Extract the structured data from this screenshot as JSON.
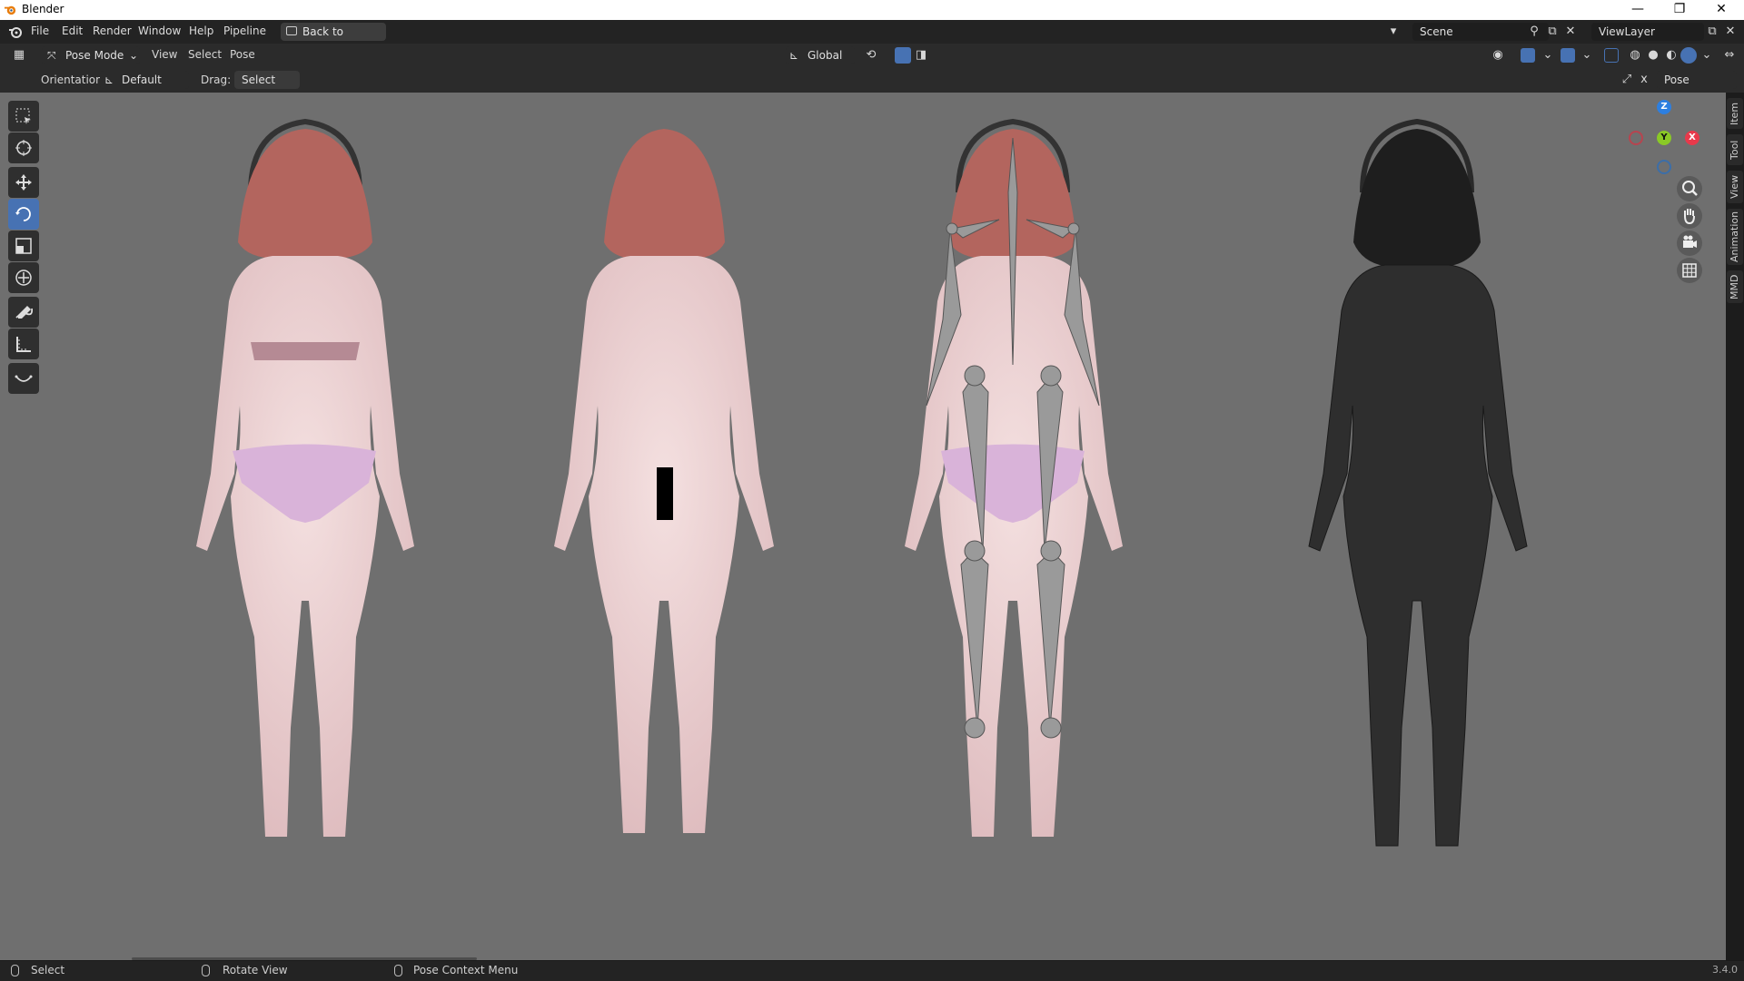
{
  "window": {
    "title": "Blender",
    "minimize": "—",
    "maximize": "❐",
    "close": "✕"
  },
  "menu": {
    "items": [
      "File",
      "Edit",
      "Render",
      "Window",
      "Help",
      "Pipeline"
    ],
    "back_label": "Back to Previous"
  },
  "scene": {
    "label": "Scene",
    "viewlayer": "ViewLayer"
  },
  "header": {
    "mode": "Pose Mode",
    "menus": [
      "View",
      "Select",
      "Pose"
    ],
    "transform_orientation": "Global"
  },
  "tool_settings": {
    "orientation_label": "Orientation:",
    "orientation_value": "Default",
    "drag_label": "Drag:",
    "drag_value": "Select Box",
    "pose_options": "Pose Options"
  },
  "sidebar_tabs": [
    "Item",
    "Tool",
    "View",
    "Animation",
    "MMD"
  ],
  "gizmo": {
    "z": "Z",
    "y": "Y",
    "x": "X"
  },
  "status": {
    "select": "Select",
    "rotate": "Rotate View",
    "context": "Pose Context Menu",
    "version": "3.4.0"
  },
  "colors": {
    "accent": "#4772b3",
    "viewport_bg": "#6f6f6f",
    "gizmo_x": "#e8394b",
    "gizmo_y": "#8ac926",
    "gizmo_z": "#2d7fe0"
  },
  "icons": [
    "blender-logo-icon",
    "select-box-icon",
    "cursor-icon",
    "move-icon",
    "rotate-icon",
    "scale-icon",
    "transform-icon",
    "annotate-icon",
    "measure-icon",
    "bone-tool-icon",
    "zoom-icon",
    "hand-icon",
    "camera-icon",
    "grid-icon"
  ]
}
